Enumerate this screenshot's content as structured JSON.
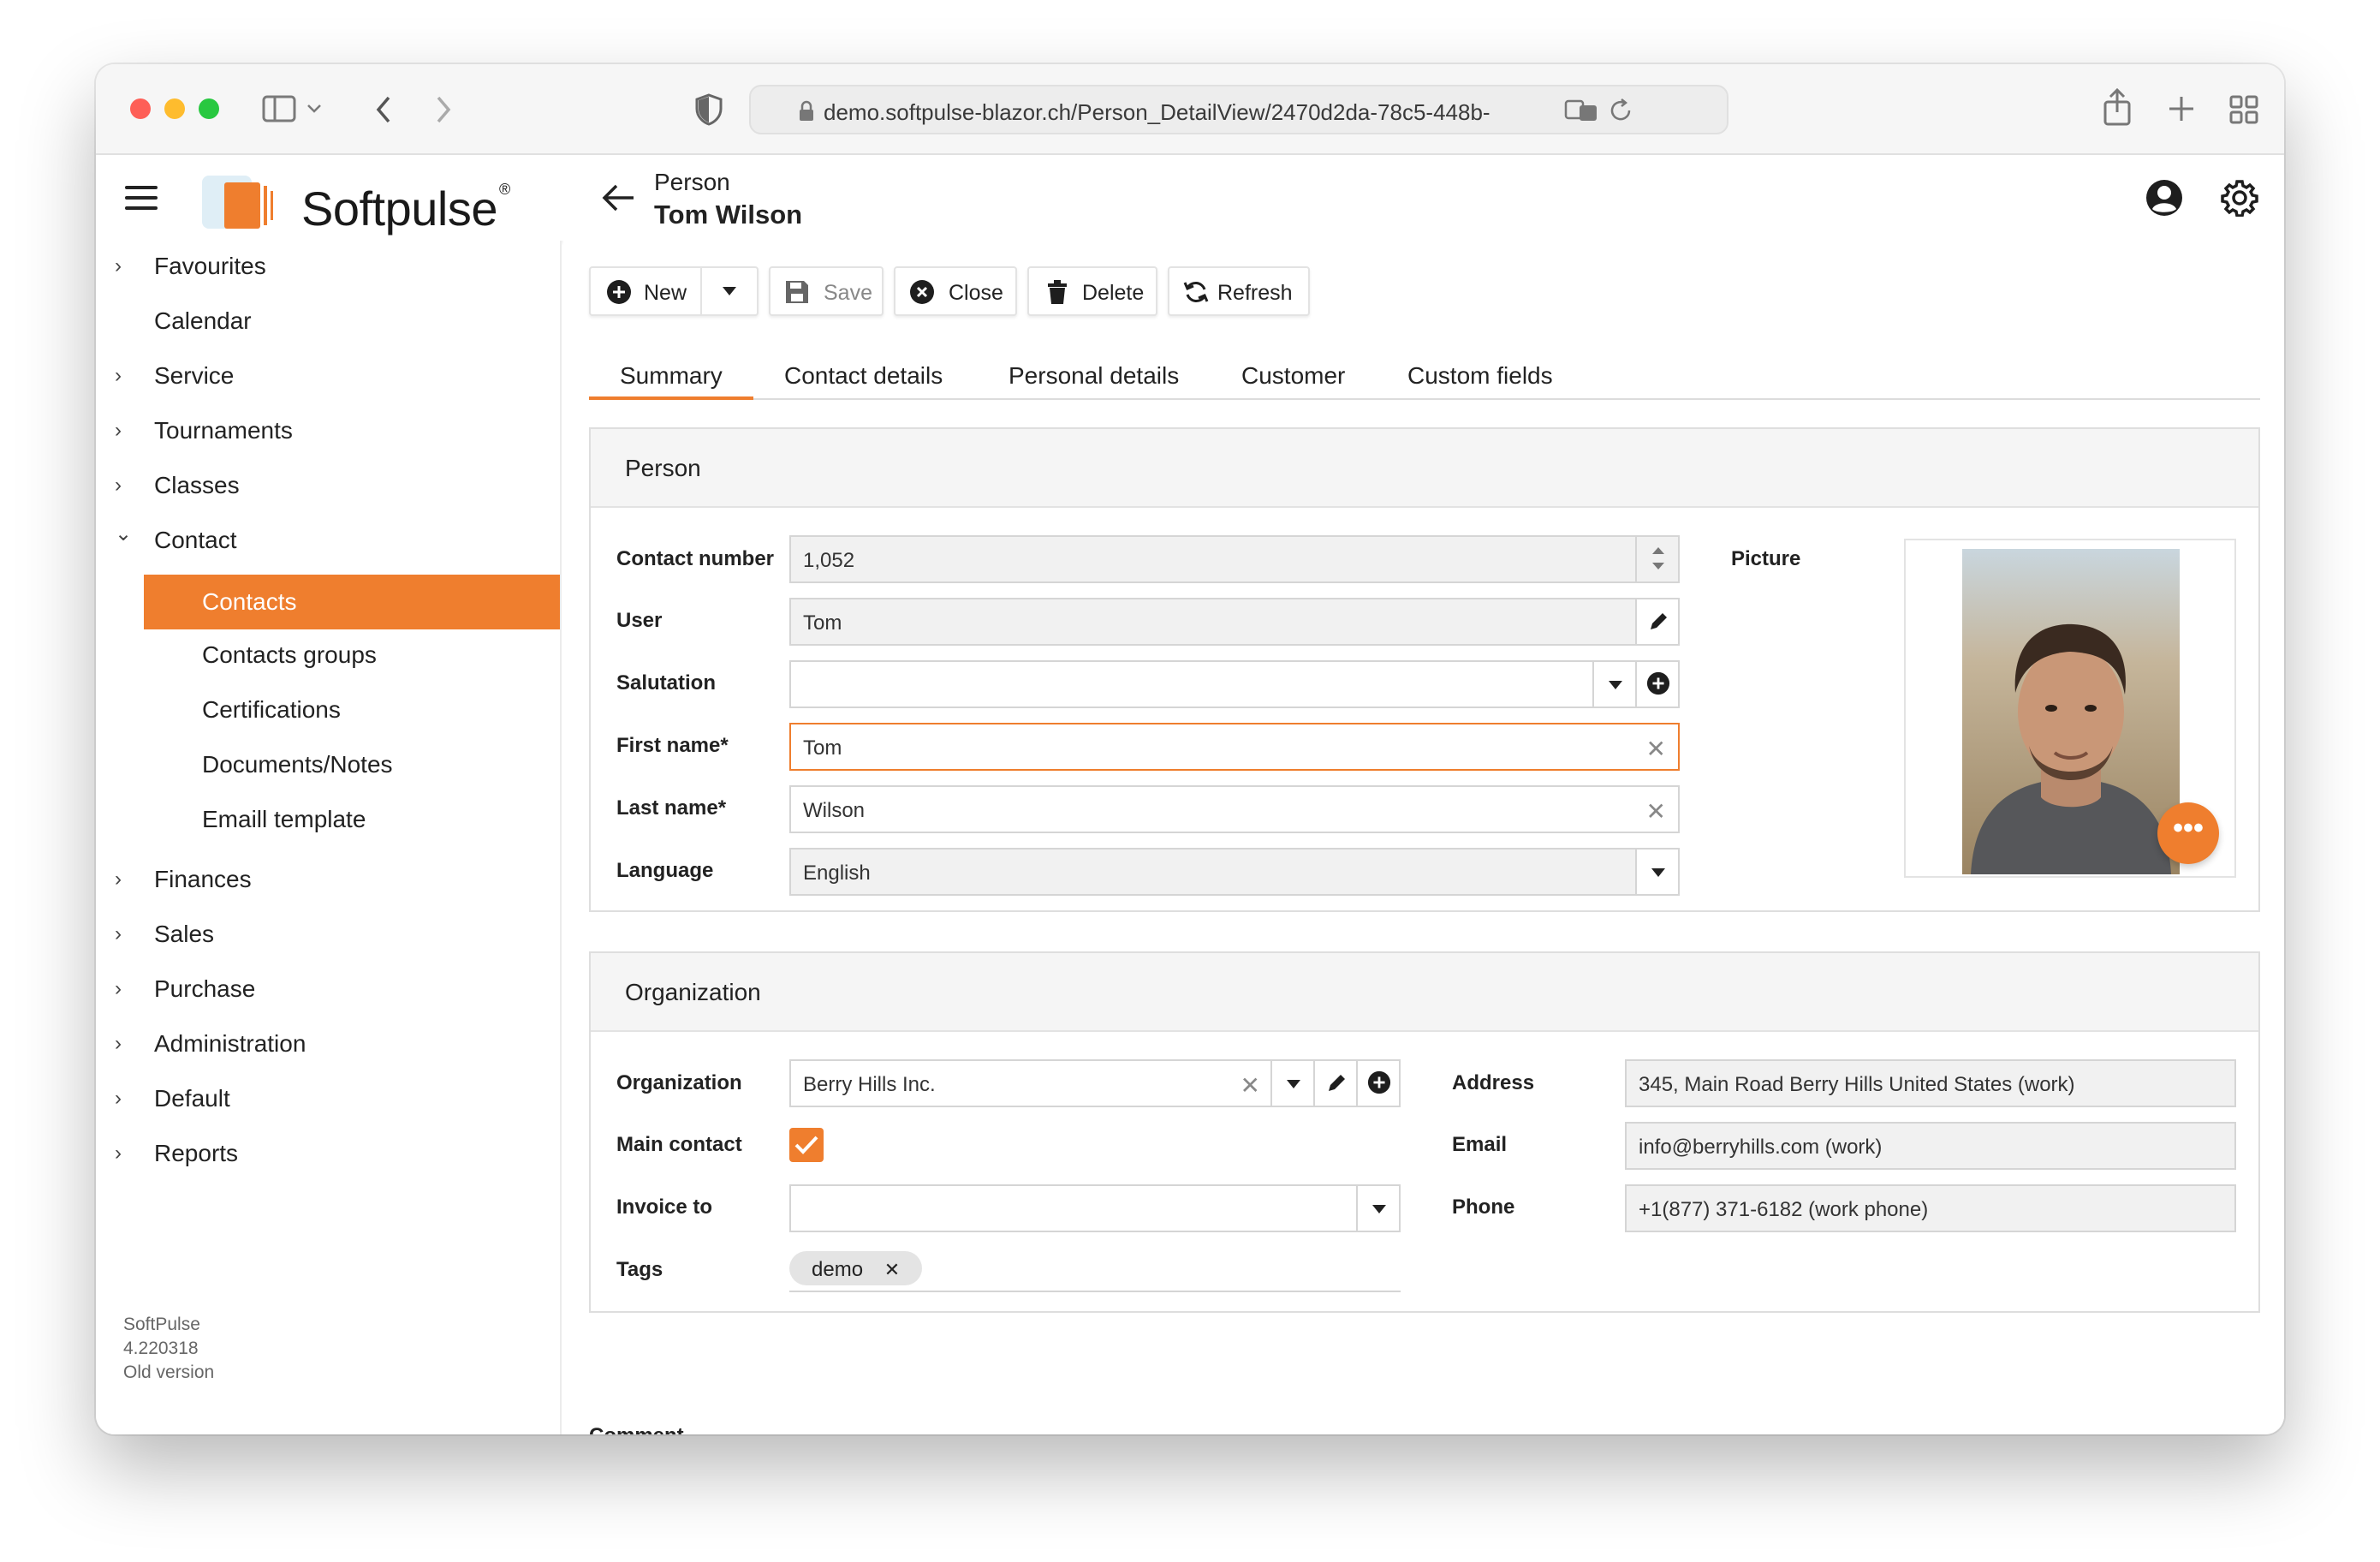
{
  "browser": {
    "url": "demo.softpulse-blazor.ch/Person_DetailView/2470d2da-78c5-448b-"
  },
  "app": {
    "brand": "Softpulse",
    "brand_reg": "®",
    "header": {
      "subtitle": "Person",
      "title": "Tom Wilson"
    },
    "accent_color": "#ef7e2e"
  },
  "sidebar": {
    "items": [
      {
        "label": "Favourites",
        "chevron": "›"
      },
      {
        "label": "Calendar",
        "chevron": ""
      },
      {
        "label": "Service",
        "chevron": "›"
      },
      {
        "label": "Tournaments",
        "chevron": "›"
      },
      {
        "label": "Classes",
        "chevron": "›"
      },
      {
        "label": "Contact",
        "chevron": "⌄"
      },
      {
        "label": "Contacts"
      },
      {
        "label": "Contacts groups"
      },
      {
        "label": "Certifications"
      },
      {
        "label": "Documents/Notes"
      },
      {
        "label": "Emaill template"
      },
      {
        "label": "Finances",
        "chevron": "›"
      },
      {
        "label": "Sales",
        "chevron": "›"
      },
      {
        "label": "Purchase",
        "chevron": "›"
      },
      {
        "label": "Administration",
        "chevron": "›"
      },
      {
        "label": "Default",
        "chevron": "›"
      },
      {
        "label": "Reports",
        "chevron": "›"
      }
    ],
    "version": {
      "name": "SoftPulse",
      "number": "4.220318",
      "note": "Old version"
    }
  },
  "toolbar": {
    "new": "New",
    "save": "Save",
    "close": "Close",
    "delete": "Delete",
    "refresh": "Refresh"
  },
  "tabs": [
    "Summary",
    "Contact details",
    "Personal details",
    "Customer",
    "Custom fields"
  ],
  "person_panel": {
    "title": "Person",
    "contact_number": {
      "label": "Contact number",
      "value": "1,052"
    },
    "user": {
      "label": "User",
      "value": "Tom"
    },
    "salutation": {
      "label": "Salutation",
      "value": ""
    },
    "first_name": {
      "label": "First name*",
      "value": "Tom"
    },
    "last_name": {
      "label": "Last name*",
      "value": "Wilson"
    },
    "language": {
      "label": "Language",
      "value": "English"
    },
    "picture": {
      "label": "Picture",
      "more": "•••"
    }
  },
  "organization_panel": {
    "title": "Organization",
    "organization": {
      "label": "Organization",
      "value": "Berry Hills Inc."
    },
    "main_contact": {
      "label": "Main contact",
      "checked": true
    },
    "invoice_to": {
      "label": "Invoice to",
      "value": ""
    },
    "tags": {
      "label": "Tags",
      "items": [
        "demo"
      ]
    },
    "address": {
      "label": "Address",
      "value": "345, Main Road Berry Hills United States (work)"
    },
    "email": {
      "label": "Email",
      "value": "info@berryhills.com (work)"
    },
    "phone": {
      "label": "Phone",
      "value": "+1(877) 371-6182 (work phone)"
    }
  },
  "comment": {
    "label": "Comment"
  }
}
